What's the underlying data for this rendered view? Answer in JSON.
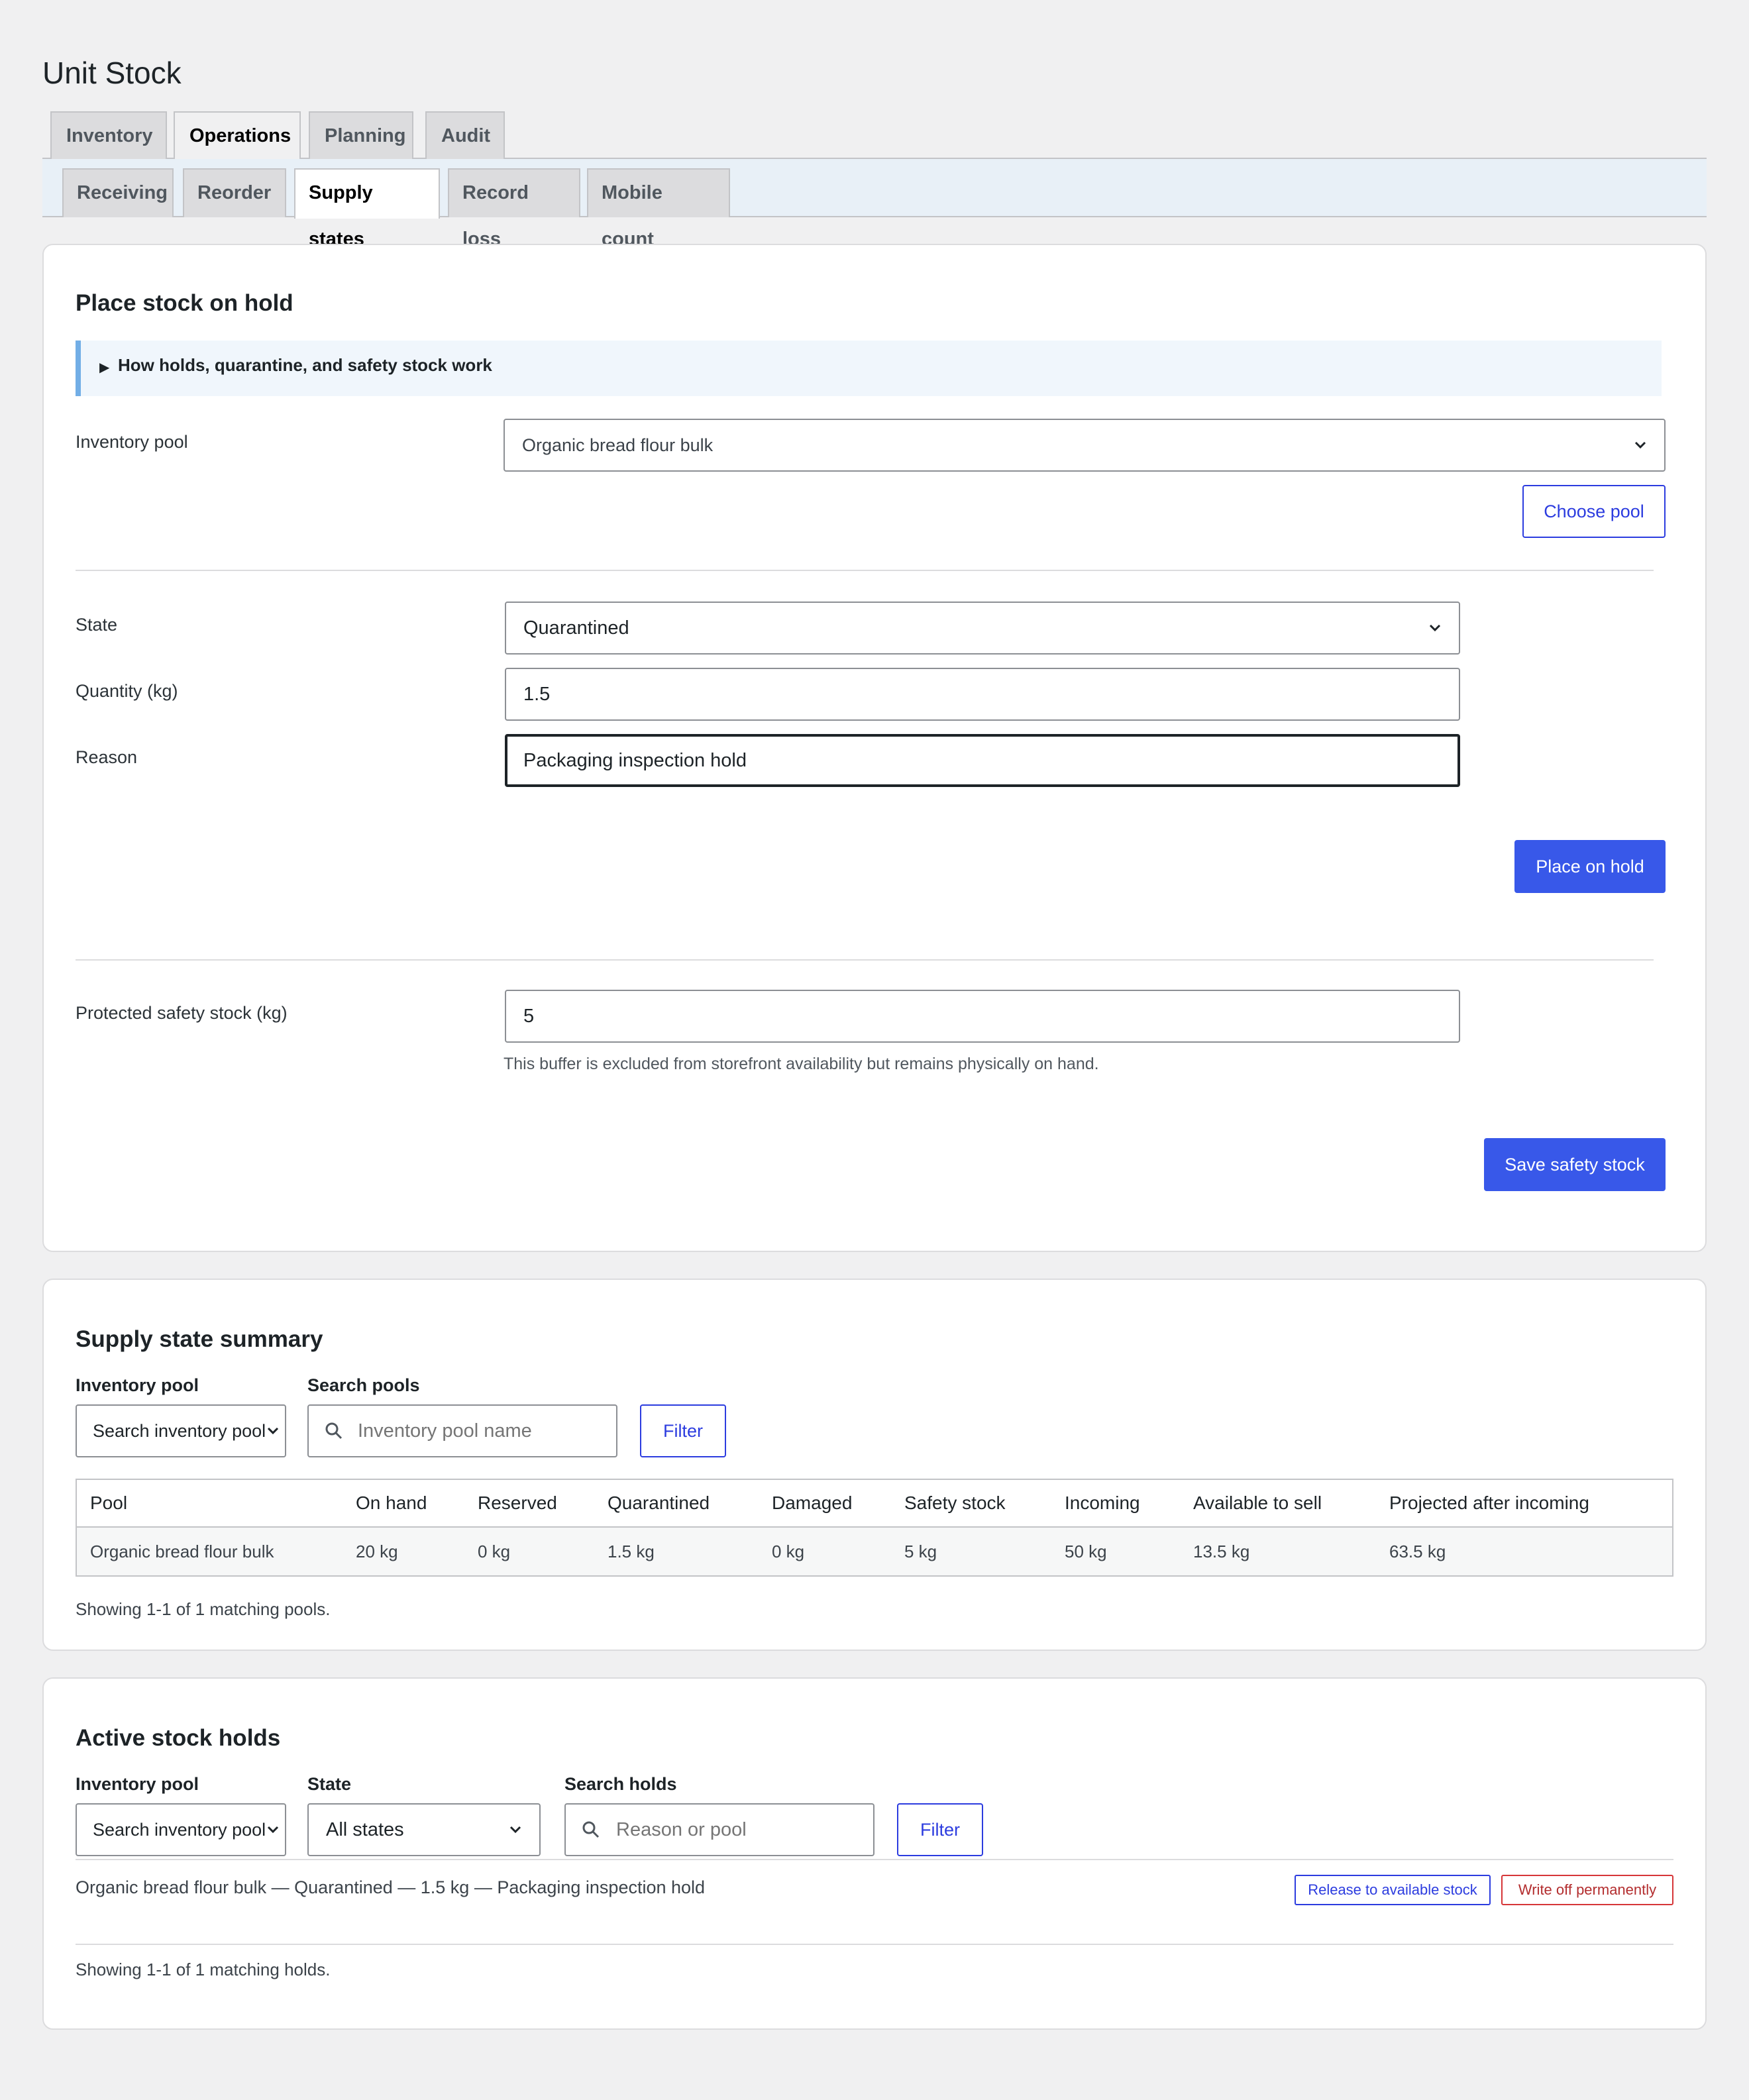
{
  "page": {
    "title": "Unit Stock"
  },
  "main_tabs": [
    {
      "label": "Inventory",
      "active": false
    },
    {
      "label": "Operations",
      "active": true
    },
    {
      "label": "Planning",
      "active": false
    },
    {
      "label": "Audit",
      "active": false
    }
  ],
  "sub_tabs": [
    {
      "label": "Receiving",
      "active": false
    },
    {
      "label": "Reorder",
      "active": false
    },
    {
      "label": "Supply states",
      "active": true
    },
    {
      "label": "Record loss",
      "active": false
    },
    {
      "label": "Mobile count",
      "active": false
    }
  ],
  "hold_form": {
    "title": "Place stock on hold",
    "info_toggle": "How holds, quarantine, and safety stock work",
    "pool_label": "Inventory pool",
    "pool_value": "Organic bread flour bulk",
    "choose_pool_button": "Choose pool",
    "state_label": "State",
    "state_value": "Quarantined",
    "quantity_label": "Quantity (kg)",
    "quantity_value": "1.5",
    "reason_label": "Reason",
    "reason_value": "Packaging inspection hold",
    "place_button": "Place on hold",
    "safety_label": "Protected safety stock (kg)",
    "safety_value": "5",
    "safety_hint": "This buffer is excluded from storefront availability but remains physically on hand.",
    "save_safety_button": "Save safety stock"
  },
  "summary": {
    "title": "Supply state summary",
    "pool_filter_label": "Inventory pool",
    "pool_filter_value": "Search inventory pools",
    "search_label": "Search pools",
    "search_placeholder": "Inventory pool name",
    "filter_button": "Filter",
    "columns": [
      "Pool",
      "On hand",
      "Reserved",
      "Quarantined",
      "Damaged",
      "Safety stock",
      "Incoming",
      "Available to sell",
      "Projected after incoming"
    ],
    "rows": [
      [
        "Organic bread flour bulk",
        "20 kg",
        "0 kg",
        "1.5 kg",
        "0 kg",
        "5 kg",
        "50 kg",
        "13.5 kg",
        "63.5 kg"
      ]
    ],
    "showing": "Showing 1-1 of 1 matching pools."
  },
  "holds": {
    "title": "Active stock holds",
    "pool_filter_label": "Inventory pool",
    "pool_filter_value": "Search inventory pools",
    "state_filter_label": "State",
    "state_filter_value": "All states",
    "search_label": "Search holds",
    "search_placeholder": "Reason or pool",
    "filter_button": "Filter",
    "items": [
      {
        "text": "Organic bread flour bulk — Quarantined — 1.5 kg — Packaging inspection hold",
        "release_button": "Release to available stock",
        "writeoff_button": "Write off permanently"
      }
    ],
    "showing": "Showing 1-1 of 1 matching holds."
  },
  "colors": {
    "primary": "#3858e9",
    "link": "#2c3cdf",
    "danger": "#d63638",
    "info_border": "#72aee6"
  }
}
